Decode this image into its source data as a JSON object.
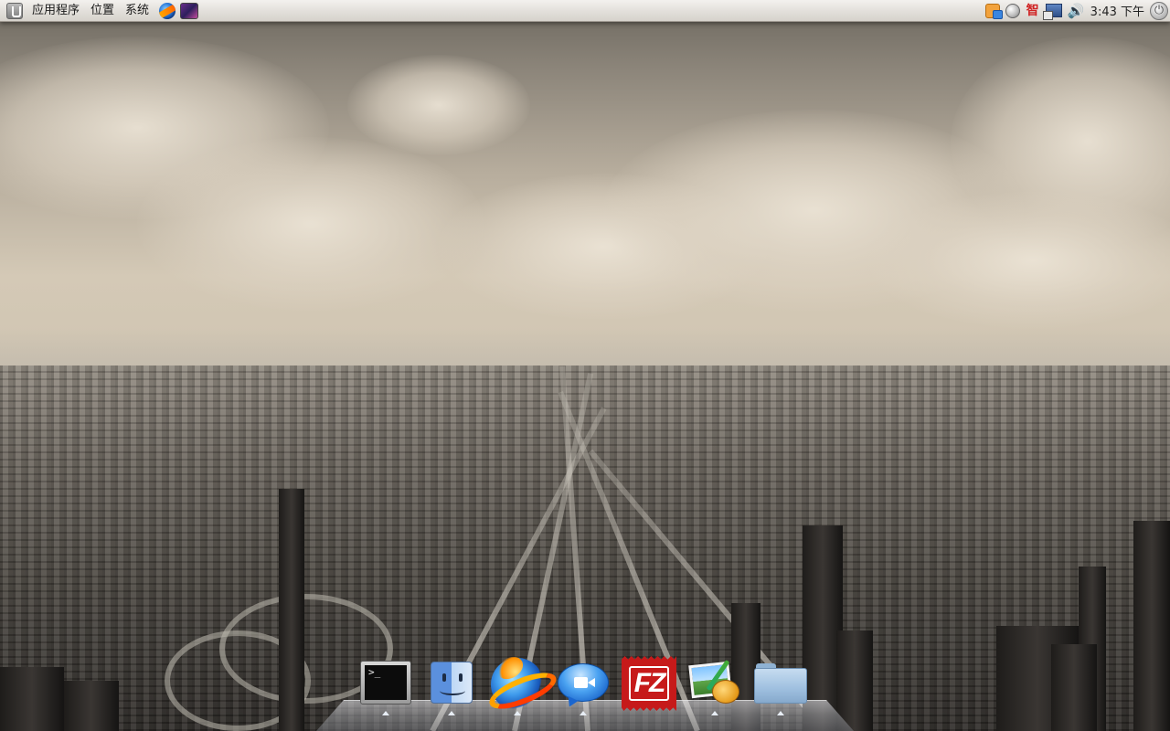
{
  "top_panel": {
    "menus": [
      {
        "label": "应用程序"
      },
      {
        "label": "位置"
      },
      {
        "label": "系统"
      }
    ],
    "launchers": [
      {
        "icon": "web-browser-icon"
      },
      {
        "icon": "system-monitor-icon"
      }
    ],
    "tray": {
      "icons": [
        "chat-notification-icon",
        "update-icon",
        "input-method-icon",
        "network-icon",
        "volume-icon"
      ],
      "ime_glyph": "智",
      "volume_glyph": "🔊"
    },
    "clock": "3:43 下午",
    "power_glyph": "⏻"
  },
  "dock": {
    "items": [
      {
        "icon": "terminal-icon",
        "glyph": ">_",
        "running": true
      },
      {
        "icon": "finder-icon",
        "running": true
      },
      {
        "icon": "internet-explorer-icon",
        "running": true
      },
      {
        "icon": "video-chat-icon",
        "running": true
      },
      {
        "icon": "filezilla-icon",
        "glyph": "FZ",
        "running": false
      },
      {
        "icon": "image-viewer-icon",
        "running": true
      },
      {
        "icon": "folder-icon",
        "running": true
      }
    ]
  },
  "colors": {
    "panel_top": "#f3f1ee",
    "panel_bottom": "#d6d2cc",
    "sky": "#cfc4b1",
    "filezilla_red": "#c61a1a"
  }
}
